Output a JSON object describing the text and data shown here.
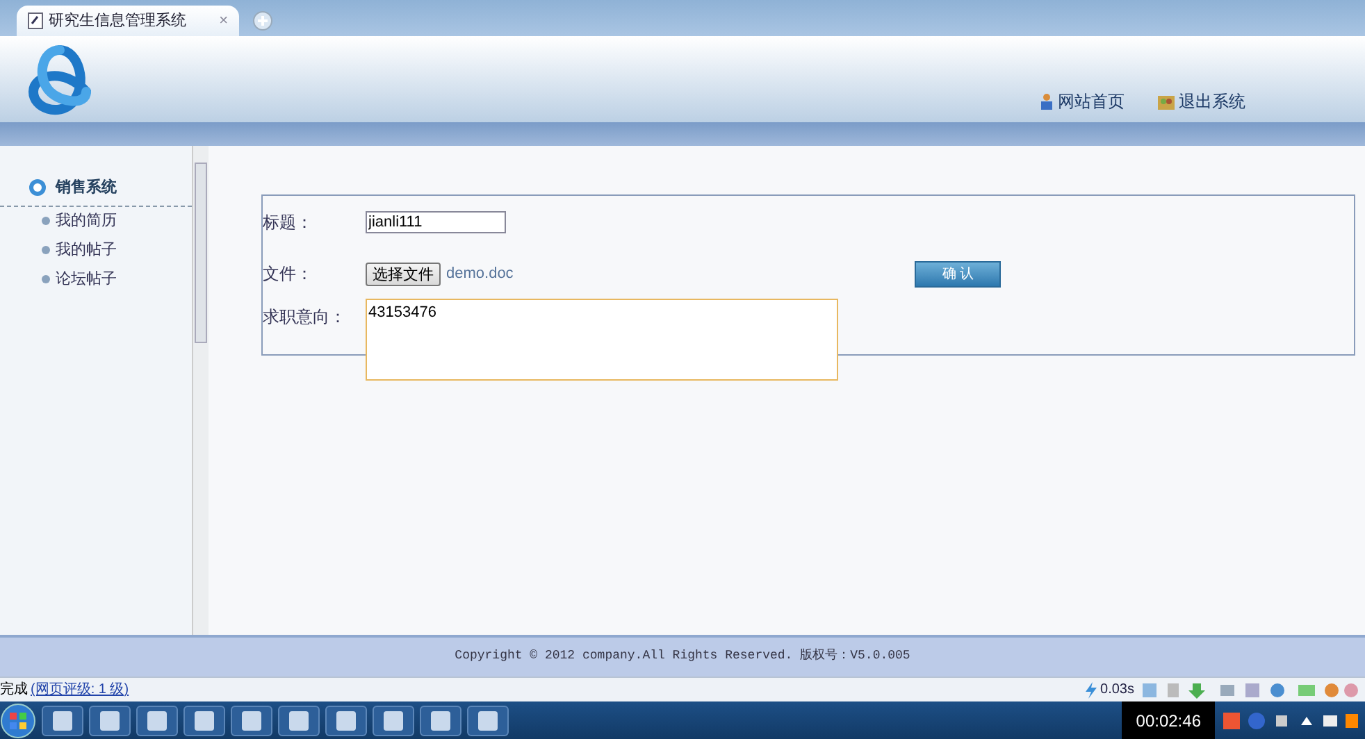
{
  "browser_tab": {
    "title": "研究生信息管理系统",
    "close": "×"
  },
  "header": {
    "links": [
      {
        "label": "网站首页",
        "kind": "home"
      },
      {
        "label": "退出系统",
        "kind": "exit"
      }
    ]
  },
  "sidebar": {
    "section": "销售系统",
    "items": [
      {
        "label": "我的简历"
      },
      {
        "label": "我的帖子"
      },
      {
        "label": "论坛帖子"
      }
    ]
  },
  "form": {
    "title_label": "标题：",
    "title_value": "jianli111",
    "file_label": "文件：",
    "file_button": "选择文件",
    "file_name": "demo.doc",
    "confirm": "确 认",
    "intention_label": "求职意向：",
    "intention_value": "43153476"
  },
  "footer": {
    "copyright": "Copyright © 2012 company.All Rights Reserved. 版权号：V5.0.005"
  },
  "status_bar": {
    "text": "完成",
    "rating_link": "(网页评级: 1 级)",
    "speed": "0.03s"
  },
  "taskbar": {
    "clock": "00:02:46"
  }
}
